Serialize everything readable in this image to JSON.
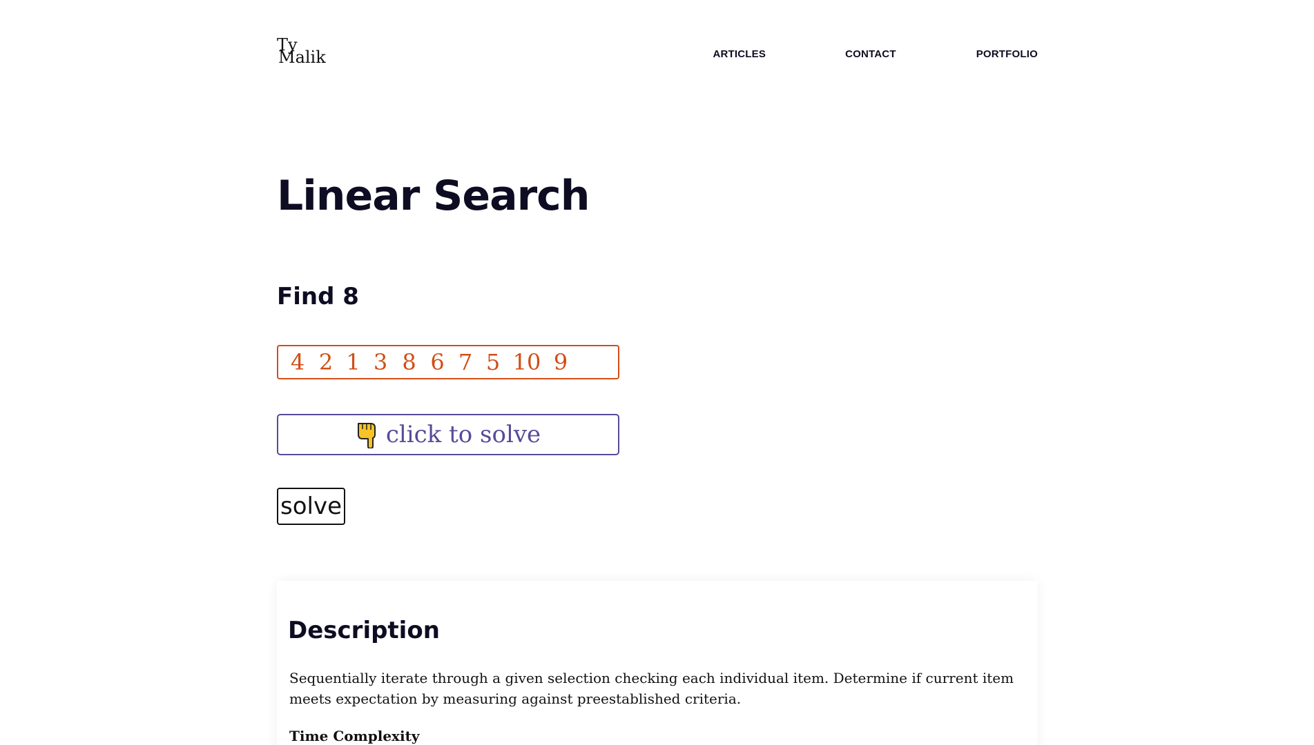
{
  "header": {
    "logo_line1": "Ty",
    "logo_line2": "Malik",
    "nav": [
      "ARTICLES",
      "CONTACT",
      "PORTFOLIO"
    ]
  },
  "main": {
    "title": "Linear Search",
    "find_label": "Find 8",
    "array": [
      "4",
      "2",
      "1",
      "3",
      "8",
      "6",
      "7",
      "5",
      "10",
      "9"
    ],
    "click_to_solve": "click to solve",
    "hand_icon": "pointing-hand-icon",
    "solve_label": "solve"
  },
  "description": {
    "heading": "Description",
    "text": "Sequentially iterate through a given selection checking each individual item. Determine if current item meets expectation by measuring against preestablished criteria.",
    "subheading": "Time Complexity"
  },
  "colors": {
    "array_accent": "#d24d14",
    "click_accent": "#564b97",
    "text": "#0d0c22"
  }
}
